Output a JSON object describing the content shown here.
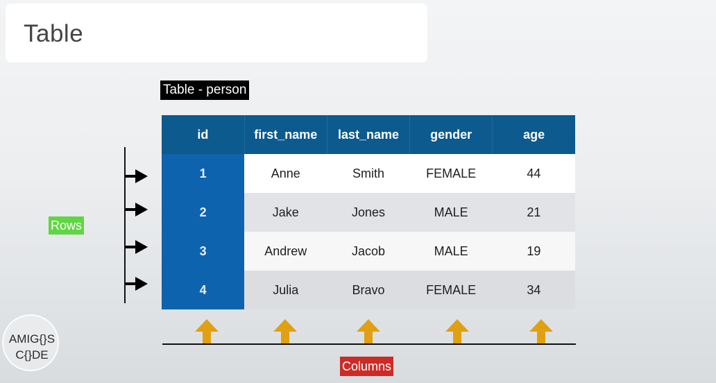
{
  "slide": {
    "title": "Table",
    "table_caption": "Table - person",
    "rows_label": "Rows",
    "columns_label": "Columns"
  },
  "table": {
    "columns": [
      "id",
      "first_name",
      "last_name",
      "gender",
      "age"
    ],
    "rows": [
      [
        "1",
        "Anne",
        "Smith",
        "FEMALE",
        "44"
      ],
      [
        "2",
        "Jake",
        "Jones",
        "MALE",
        "21"
      ],
      [
        "3",
        "Andrew",
        "Jacob",
        "MALE",
        "19"
      ],
      [
        "4",
        "Julia",
        "Bravo",
        "FEMALE",
        "34"
      ]
    ]
  },
  "logo": {
    "line1": "AMIG{}S",
    "line2": "C{}DE"
  },
  "colors": {
    "header_bg": "#0d5a8e",
    "id_column_bg": "#0e63ae",
    "rows_label_bg": "#5fd642",
    "columns_label_bg": "#cc2b26",
    "arrow_color": "#e0a012"
  }
}
